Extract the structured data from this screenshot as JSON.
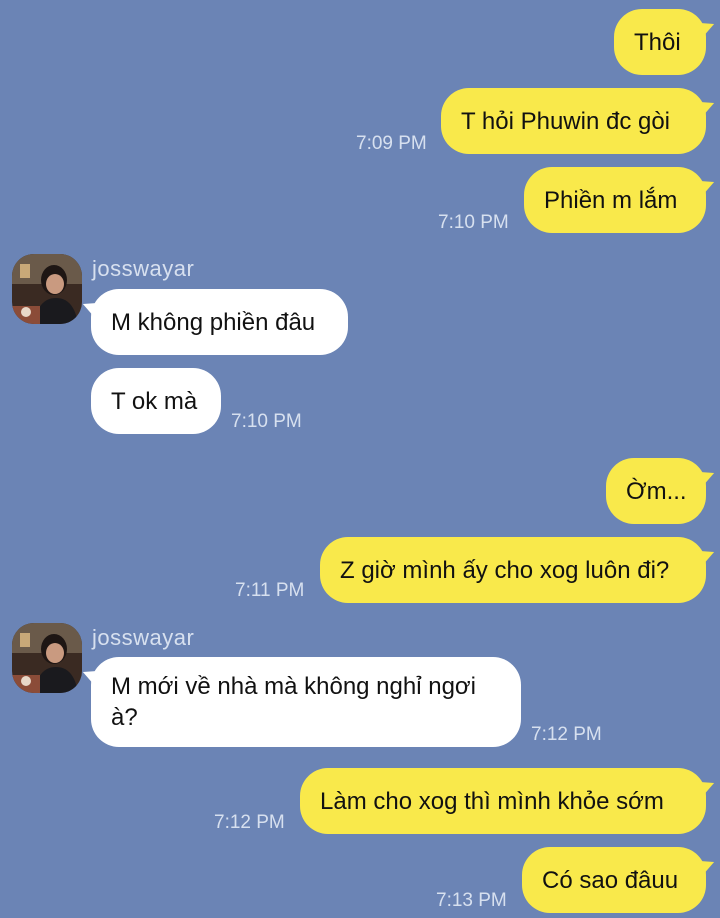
{
  "messages": [
    {
      "side": "out",
      "text": "Thôi",
      "time": ""
    },
    {
      "side": "out",
      "text": "T hỏi Phuwin đc gòi",
      "time": "7:09 PM"
    },
    {
      "side": "out",
      "text": "Phiền m lắm",
      "time": "7:10 PM"
    },
    {
      "side": "in",
      "sender": "josswayar",
      "text": "M không phiền đâu",
      "time": ""
    },
    {
      "side": "in",
      "text": "T ok mà",
      "time": "7:10 PM"
    },
    {
      "side": "out",
      "text": "Ờm...",
      "time": ""
    },
    {
      "side": "out",
      "text": "Z giờ mình ấy cho xog luôn đi?",
      "time": "7:11 PM"
    },
    {
      "side": "in",
      "sender": "josswayar",
      "text": "M mới về nhà mà không nghỉ ngơi à?",
      "time": "7:12 PM"
    },
    {
      "side": "out",
      "text": "Làm cho xog thì mình khỏe sớm",
      "time": "7:12 PM"
    },
    {
      "side": "out",
      "text": "Có sao đâuu",
      "time": "7:13 PM"
    }
  ],
  "colors": {
    "background": "#6b84b5",
    "outgoing_bubble": "#f9e94b",
    "incoming_bubble": "#ffffff",
    "meta_text": "#d7e0ef"
  }
}
